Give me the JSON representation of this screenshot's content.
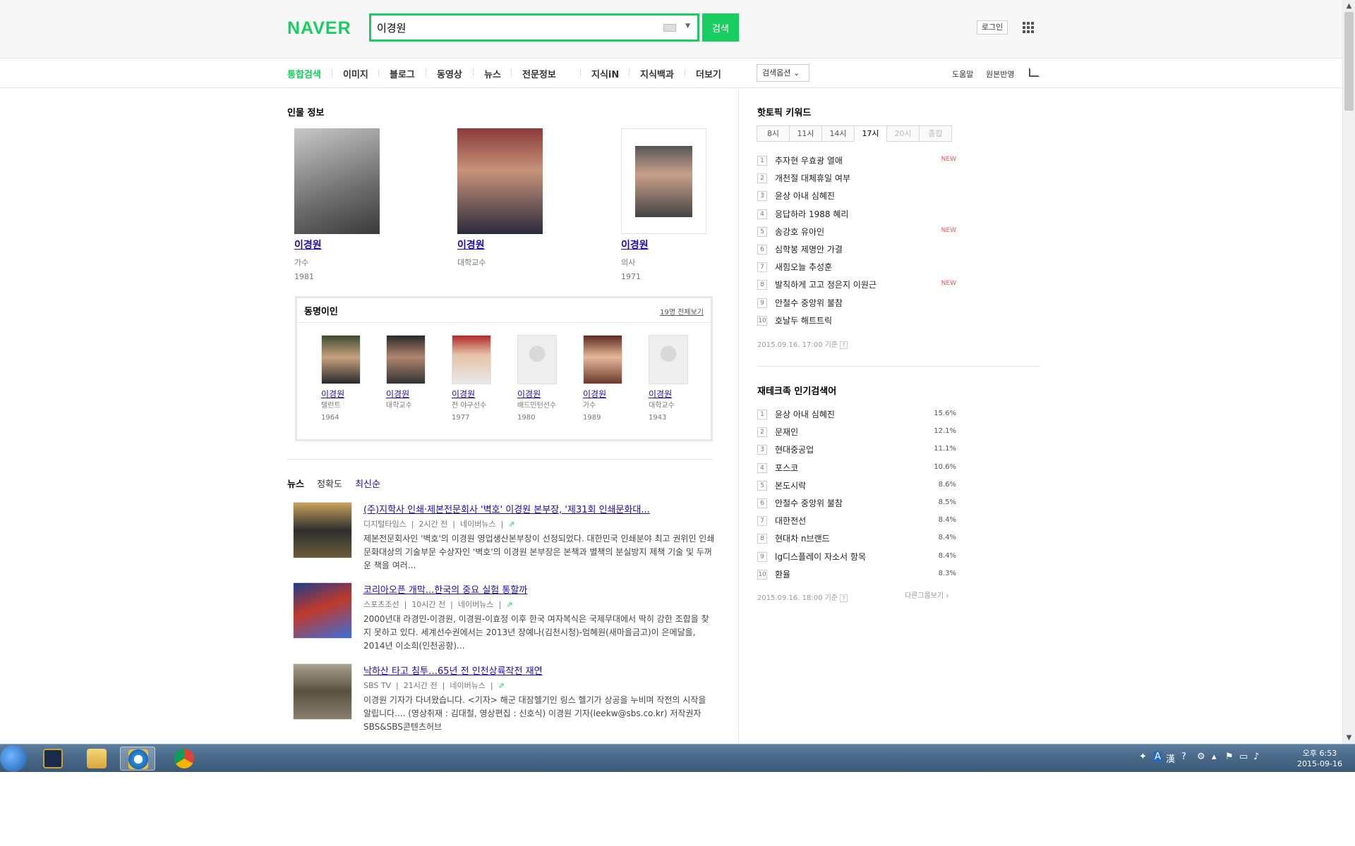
{
  "header": {
    "logo": "NAVER",
    "search_value": "이경원",
    "search_button": "검색",
    "login": "로그인"
  },
  "tabs": [
    {
      "label": "통합검색",
      "active": true
    },
    {
      "label": "이미지"
    },
    {
      "label": "블로그"
    },
    {
      "label": "동영상"
    },
    {
      "label": "뉴스"
    },
    {
      "label": "전문정보"
    },
    {
      "label": "지식iN"
    },
    {
      "label": "지식백과"
    },
    {
      "label": "더보기"
    }
  ],
  "toolbar": {
    "search_options": "검색옵션",
    "help": "도움말",
    "original": "원본반영"
  },
  "people": {
    "title": "인물 정보",
    "items": [
      {
        "name": "이경원",
        "job": "가수",
        "year": "1981"
      },
      {
        "name": "이경원",
        "job": "대학교수",
        "year": ""
      },
      {
        "name": "이경원",
        "job": "의사",
        "year": "1971"
      }
    ]
  },
  "namesakes": {
    "title": "동명이인",
    "all_link": "19명 전체보기",
    "items": [
      {
        "name": "이경원",
        "job": "탤런트",
        "year": "1964"
      },
      {
        "name": "이경원",
        "job": "대학교수",
        "year": ""
      },
      {
        "name": "이경원",
        "job": "전 야구선수",
        "year": "1977"
      },
      {
        "name": "이경원",
        "job": "배드민턴선수",
        "year": "1980"
      },
      {
        "name": "이경원",
        "job": "가수",
        "year": "1989"
      },
      {
        "name": "이경원",
        "job": "대학교수",
        "year": "1943"
      }
    ]
  },
  "news": {
    "title": "뉴스",
    "sort_accuracy": "정확도",
    "sort_latest": "최신순",
    "items": [
      {
        "title": "(주)지학사 인쇄·제본전문회사 '벽호' 이경원 본부장, '제31회 인쇄문화대...",
        "source": "디지털타임스",
        "time": "2시간 전",
        "portal": "네이버뉴스",
        "desc": "제본전문회사인 '벽호'의 이경원 영업생산본부장이 선정되었다. 대한민국 인쇄분야 최고 권위인 인쇄문화대상의 기술부문 수상자인 '벽호'의 이경원 본부장은 본책과 별책의 분실방지 제책 기술 및 두꺼운 책을 여러..."
      },
      {
        "title": "코리아오픈 개막...한국의 중요 실험 통할까",
        "source": "스포츠조선",
        "time": "10시간 전",
        "portal": "네이버뉴스",
        "desc": "2000년대 라경민-이경원, 이경원-이효정 이후 한국 여자복식은 국제무대에서 딱히 강한 조합을 찾지 못하고 있다. 세계선수권에서는 2013년 장예나(김천시청)-엄혜원(새마을금고)이 은메달을, 2014년 이소희(인천공항)..."
      },
      {
        "title": "낙하산 타고 침투…65년 전 인천상륙작전 재연",
        "source": "SBS TV",
        "time": "21시간 전",
        "portal": "네이버뉴스",
        "desc": "이경원 기자가 다녀왔습니다. <기자> 해군 대잠헬기인 링스 헬기가 상공을 누비며 작전의 시작을 알립니다.... (영상취재 : 김대철, 영상편집 : 신호식) 이경원 기자(leekw@sbs.co.kr) 저작권자 SBS&SBS콘텐츠허브"
      }
    ]
  },
  "hot_topic": {
    "title": "핫토픽 키워드",
    "time_tabs": [
      {
        "label": "8시"
      },
      {
        "label": "11시"
      },
      {
        "label": "14시"
      },
      {
        "label": "17시",
        "active": true
      },
      {
        "label": "20시",
        "dim": true
      },
      {
        "label": "종합",
        "dim": true
      }
    ],
    "items": [
      {
        "rank": "1",
        "keyword": "추자현 우효광 열애",
        "badge": "NEW"
      },
      {
        "rank": "2",
        "keyword": "개천절 대체휴일 여부",
        "badge": ""
      },
      {
        "rank": "3",
        "keyword": "윤상 아내 심혜진",
        "badge": ""
      },
      {
        "rank": "4",
        "keyword": "응답하라 1988 혜리",
        "badge": ""
      },
      {
        "rank": "5",
        "keyword": "송강호 유아인",
        "badge": "NEW"
      },
      {
        "rank": "6",
        "keyword": "심학봉 제명안 가결",
        "badge": ""
      },
      {
        "rank": "7",
        "keyword": "새힘오늘 추성훈",
        "badge": ""
      },
      {
        "rank": "8",
        "keyword": "발칙하게 고고 정은지 이원근",
        "badge": "NEW"
      },
      {
        "rank": "9",
        "keyword": "안철수 중앙위 불참",
        "badge": ""
      },
      {
        "rank": "10",
        "keyword": "호날두 해트트릭",
        "badge": ""
      }
    ],
    "timestamp": "2015.09.16. 17:00 기준"
  },
  "finance": {
    "title": "재테크족 인기검색어",
    "items": [
      {
        "rank": "1",
        "keyword": "윤상 아내 심혜진",
        "pct": "15.6%"
      },
      {
        "rank": "2",
        "keyword": "문재인",
        "pct": "12.1%"
      },
      {
        "rank": "3",
        "keyword": "현대중공업",
        "pct": "11.1%"
      },
      {
        "rank": "4",
        "keyword": "포스코",
        "pct": "10.6%"
      },
      {
        "rank": "5",
        "keyword": "본도시락",
        "pct": "8.6%"
      },
      {
        "rank": "6",
        "keyword": "안철수 중앙위 불참",
        "pct": "8.5%"
      },
      {
        "rank": "7",
        "keyword": "대한전선",
        "pct": "8.4%"
      },
      {
        "rank": "8",
        "keyword": "현대차 n브랜드",
        "pct": "8.4%"
      },
      {
        "rank": "9",
        "keyword": "lg디스플레이 자소서 항목",
        "pct": "8.4%"
      },
      {
        "rank": "10",
        "keyword": "환율",
        "pct": "8.3%"
      }
    ],
    "timestamp": "2015.09.16. 18:00 기준",
    "more": "다른그룹보기"
  },
  "taskbar": {
    "time": "오후 6:53",
    "date": "2015-09-16"
  },
  "colors": {
    "brand": "#19ce60",
    "link": "#1a0dab",
    "new_badge": "#ff4e4e"
  }
}
